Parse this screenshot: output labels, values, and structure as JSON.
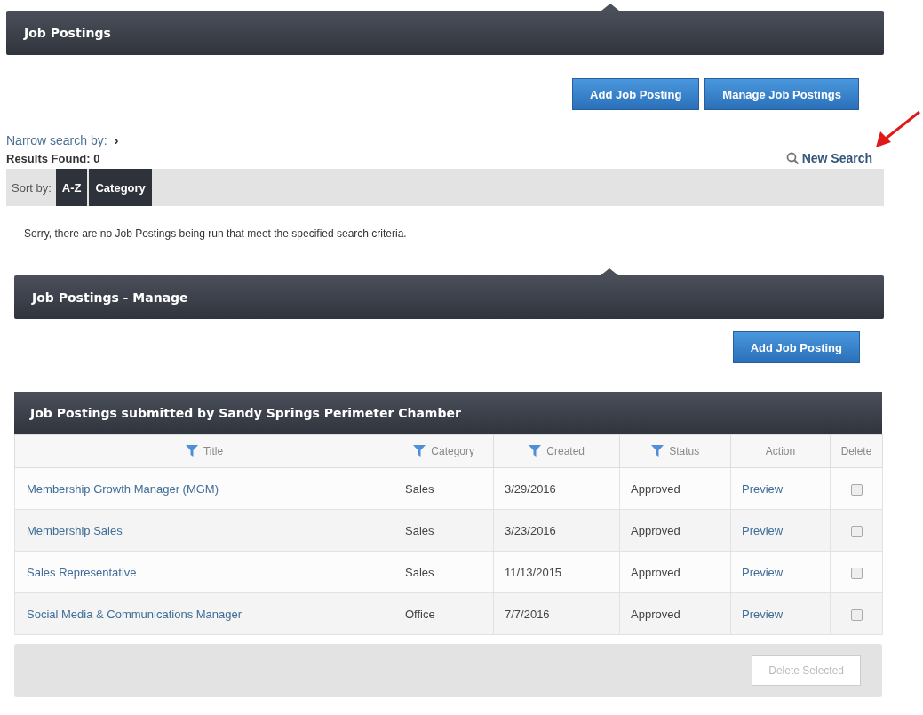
{
  "search_panel": {
    "title": "Job Postings",
    "buttons": [
      "Add Job Posting",
      "Manage Job Postings"
    ],
    "narrow_search": "Narrow search by:",
    "narrow_expander": "›",
    "results": "Results Found: 0",
    "new_search": "New Search",
    "sort_label": "Sort by:",
    "sort_options": [
      {
        "label": "A-Z",
        "selected": false
      },
      {
        "label": "Category",
        "selected": false
      }
    ],
    "message": "Sorry, there are no Job Postings being run that meet the specified search criteria."
  },
  "manage_panel": {
    "title": "Job Postings - Manage",
    "button": "Add Job Posting",
    "table": {
      "title": "Job Postings submitted by Sandy Springs Perimeter Chamber",
      "columns": [
        {
          "label": "Title",
          "filter": true
        },
        {
          "label": "Category",
          "filter": true
        },
        {
          "label": "Created",
          "filter": true
        },
        {
          "label": "Status",
          "filter": true
        },
        {
          "label": "Action",
          "filter": false
        },
        {
          "label": "Delete",
          "filter": false
        }
      ],
      "rows": [
        {
          "title": "Membership Growth Manager (MGM)",
          "category": "Sales",
          "created": "3/29/2016",
          "status": "Approved",
          "action": "Preview",
          "checked": false
        },
        {
          "title": "Membership Sales",
          "category": "Sales",
          "created": "3/23/2016",
          "status": "Approved",
          "action": "Preview",
          "checked": false
        },
        {
          "title": "Sales Representative",
          "category": "Sales",
          "created": "11/13/2015",
          "status": "Approved",
          "action": "Preview",
          "checked": false
        },
        {
          "title": "Social Media & Communications Manager",
          "category": "Office",
          "created": "7/7/2016",
          "status": "Approved",
          "action": "Preview",
          "checked": false
        }
      ],
      "delete_button": {
        "label": "Delete Selected",
        "disabled": true
      }
    }
  }
}
